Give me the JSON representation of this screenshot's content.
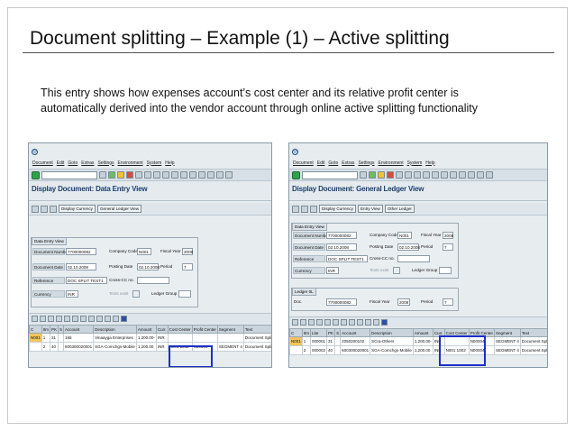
{
  "slide": {
    "title": "Document splitting – Example (1) – Active splitting",
    "description_line1": "This entry shows how expenses account’s cost center and its relative profit center is",
    "description_line2": "automatically derived into the vendor account through online active splitting functionality"
  },
  "colors": {
    "highlight": "#1c2fc8",
    "sap_title": "#1c3f6e",
    "panel_bg": "#e7ecef"
  },
  "left": {
    "menu": [
      "Document",
      "Edit",
      "Goto",
      "Extras",
      "Settings",
      "Environment",
      "System",
      "Help"
    ],
    "screen_title": "Display Document: Data Entry View",
    "app_buttons": [
      "Display Currency",
      "General Ledger View"
    ],
    "group_title": "Data Entry View",
    "fields": {
      "doc_number_label": "Document Number",
      "doc_number": "7700000082",
      "company_code_label": "Company Code",
      "company_code": "N001",
      "fiscal_year_label": "Fiscal Year",
      "fiscal_year": "2008",
      "doc_date_label": "Document Date",
      "doc_date": "02.10.2008",
      "posting_date_label": "Posting Date",
      "posting_date": "02.10.2008",
      "period_label": "Period",
      "period": "7",
      "reference_label": "Reference",
      "reference": "DOC SPLIT TEST1",
      "cross_cc_label": "Cross-CC no.",
      "currency_label": "Currency",
      "currency": "INR",
      "texts_exist_label": "Texts exist",
      "ledger_group_label": "Ledger Group"
    },
    "table": {
      "headers": [
        "C",
        "Itm",
        "PK",
        "S",
        "Account",
        "Description",
        "Amount",
        "Curr.",
        "Cost Center",
        "Profit Center",
        "Segment",
        "Text"
      ],
      "rows": [
        [
          "N001",
          "1",
          "31",
          "",
          "166",
          "Vinaayga Enterprises",
          "1,200.00-",
          "INR",
          "",
          "",
          "",
          "Document Splitting Test"
        ],
        [
          "",
          "2",
          "40",
          "",
          "600300020001",
          "SGA-Comchgs-Mobile",
          "1,200.00",
          "INR",
          "N001 1002",
          "N00004",
          "SEGMENT 4",
          "Document Splitting Test"
        ]
      ]
    }
  },
  "right": {
    "menu": [
      "Document",
      "Edit",
      "Goto",
      "Extras",
      "Settings",
      "Environment",
      "System",
      "Help"
    ],
    "screen_title": "Display Document: General Ledger View",
    "app_buttons": [
      "Display Currency",
      "Entry View",
      "Other Ledger"
    ],
    "group_title": "Data Entry View",
    "fields": {
      "doc_number_label": "Document Number",
      "doc_number": "7700000082",
      "company_code_label": "Company Code",
      "company_code": "N001",
      "fiscal_year_label": "Fiscal Year",
      "fiscal_year": "2008",
      "doc_date_label": "Document Date",
      "doc_date": "02.10.2008",
      "posting_date_label": "Posting Date",
      "posting_date": "02.10.2008",
      "period_label": "Period",
      "period": "7",
      "reference_label": "Reference",
      "reference": "DOC SPLIT TEST1",
      "cross_cc_label": "Cross-CC no.",
      "currency_label": "Currency",
      "currency": "INR",
      "texts_exist_label": "Texts exist",
      "ledger_group_label": "Ledger Group"
    },
    "ledger_group_title": "Ledger 0L",
    "ledger_fields": {
      "doc_label": "Doc.",
      "doc": "7700000082",
      "fiscal_year_label": "Fiscal Year",
      "fiscal_year": "2008",
      "period_label": "Period",
      "period": "7"
    },
    "table": {
      "headers": [
        "C",
        "Itm",
        "Lite",
        "PK",
        "S",
        "Account",
        "Description",
        "Amount",
        "Curr.",
        "Cost Center",
        "Profit Center",
        "Segment",
        "Text"
      ],
      "rows": [
        [
          "N001",
          "1",
          "000001",
          "31",
          "",
          "2050200102",
          "SCra-Others",
          "1,200.00-",
          "INR",
          "",
          "N00004",
          "SEGMENT 4",
          "Document Splitting Test"
        ],
        [
          "",
          "2",
          "000002",
          "40",
          "",
          "600300020001",
          "SGA-Comchgs-Mobile",
          "1,200.00",
          "INR",
          "N001 1002",
          "N00004",
          "SEGMENT 4",
          "Document Splitting Test"
        ]
      ]
    }
  }
}
